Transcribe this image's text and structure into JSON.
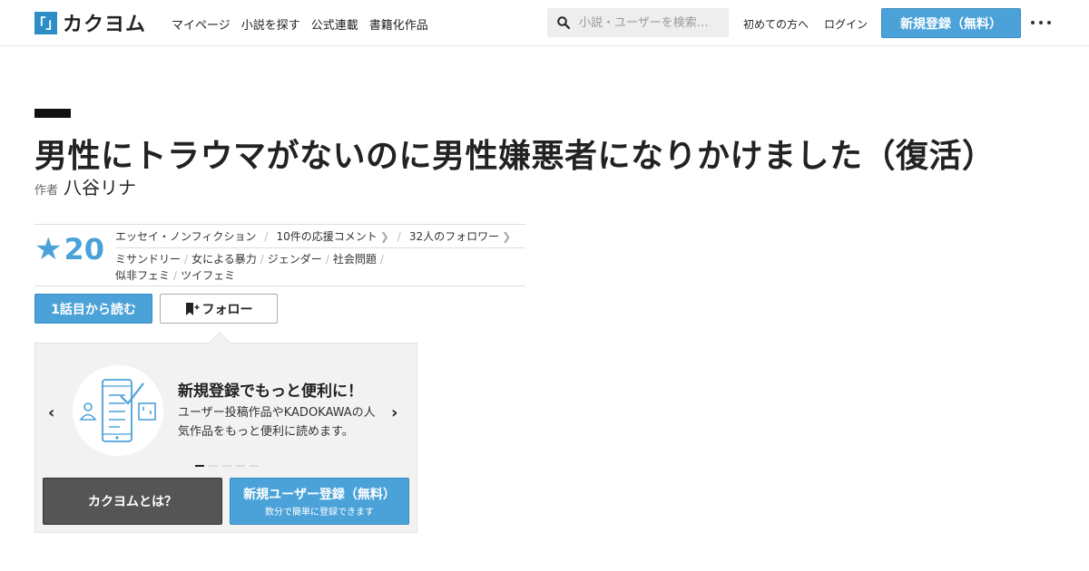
{
  "brand": {
    "logo_mark": "「」",
    "name": "カクヨム",
    "accent_color": "#4aa2d9"
  },
  "nav": {
    "items": [
      "マイページ",
      "小説を探す",
      "公式連載",
      "書籍化作品"
    ]
  },
  "search": {
    "placeholder": "小説・ユーザーを検索…",
    "icon": "search-icon"
  },
  "header_links": {
    "first_time": "初めての方へ",
    "login": "ログイン",
    "signup": "新規登録（無料）",
    "more_icon": "more-icon"
  },
  "work": {
    "title": "男性にトラウマがないのに男性嫌悪者になりかけました（復活）",
    "author_label": "作者",
    "author_name": "八谷リナ",
    "rating_star": "★",
    "rating": "20",
    "genre": "エッセイ・ノンフィクション",
    "comments": "10件の応援コメント",
    "followers": "32人のフォロワー",
    "tags": [
      "ミサンドリー",
      "女による暴力",
      "ジェンダー",
      "社会問題",
      "似非フェミ",
      "ツイフェミ"
    ]
  },
  "actions": {
    "read_first": "1話目から読む",
    "follow": "フォロー",
    "follow_icon": "bookmark-plus-icon"
  },
  "promo": {
    "title": "新規登録でもっと便利に！",
    "description": "ユーザー投稿作品やKADOKAWAの人気作品をもっと便利に読めます。",
    "prev_icon": "chevron-left-icon",
    "next_icon": "chevron-right-icon",
    "slide_count": 5,
    "active_slide": 1,
    "about_button": "カクヨムとは？",
    "register_button": "新規ユーザー登録（無料）",
    "register_sub": "数分で簡単に登録できます"
  }
}
